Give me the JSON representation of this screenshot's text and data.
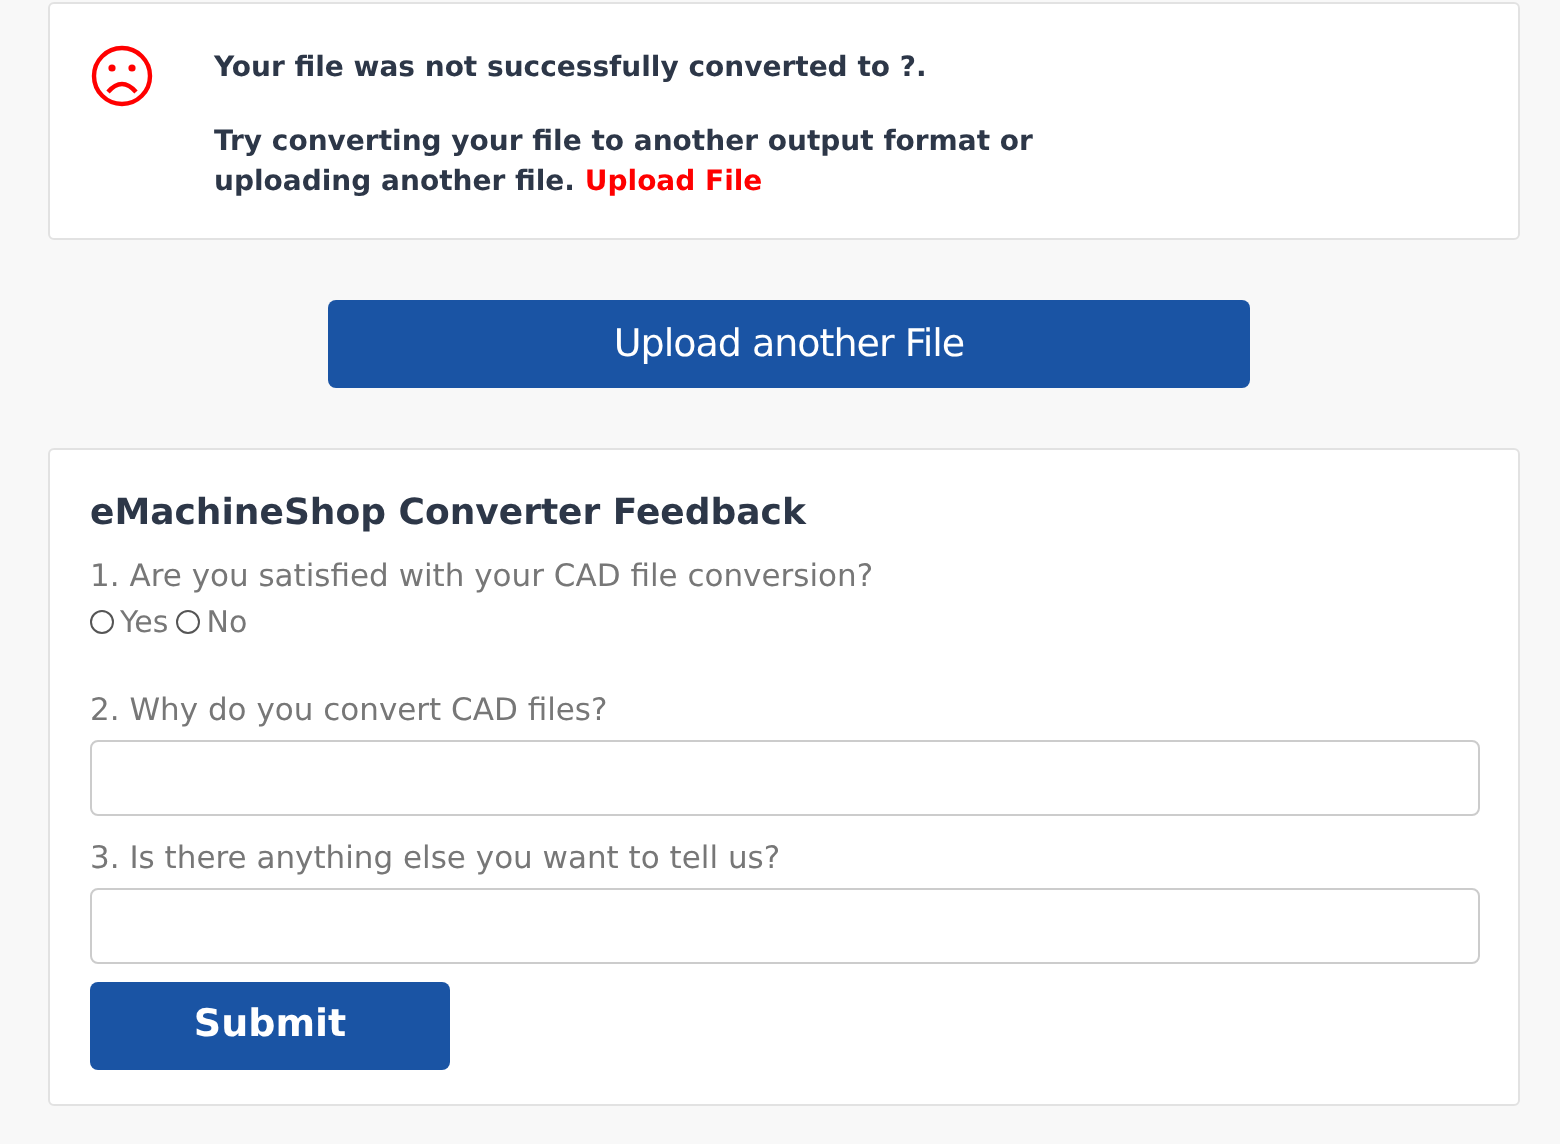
{
  "error_notice": {
    "title": "Your file was not successfully converted to ?.",
    "message": "Try converting your file to another output format or uploading another file.",
    "link": "Upload File"
  },
  "upload_button": "Upload another File",
  "feedback": {
    "title": "eMachineShop Converter Feedback",
    "questions": [
      {
        "kind": "radio",
        "label": "1. Are you satisfied with your CAD file conversion?",
        "options": [
          {
            "label": "Yes",
            "selected": false
          },
          {
            "label": "No",
            "selected": false
          }
        ]
      },
      {
        "kind": "text",
        "label": "2. Why do you convert CAD files?"
      },
      {
        "kind": "text",
        "label": "3. Is there anything else you want to tell us?"
      }
    ],
    "submit": "Submit"
  }
}
